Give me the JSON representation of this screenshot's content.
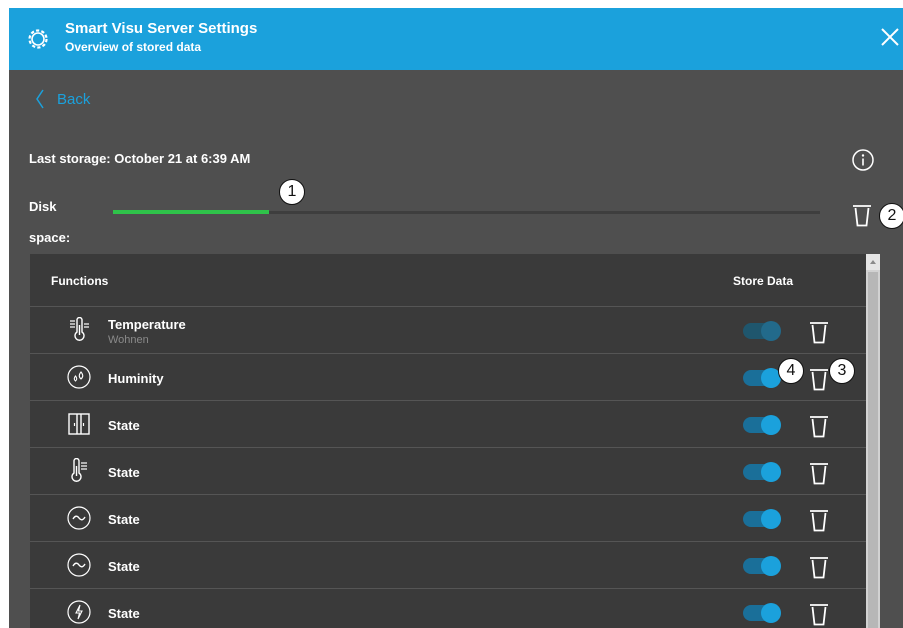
{
  "header": {
    "title": "Smart Visu Server Settings",
    "subtitle": "Overview of stored data",
    "settings_icon": "gear-icon",
    "close_icon": "close-icon"
  },
  "nav": {
    "back_label": "Back"
  },
  "storage": {
    "last_storage_label": "Last storage: October 21 at 6:39 AM",
    "disk_space_label": "Disk space:",
    "disk_used_fraction": 0.22,
    "info_icon": "info-icon",
    "delete_icon": "trash-icon"
  },
  "table": {
    "col_functions": "Functions",
    "col_store_data": "Store Data",
    "rows": [
      {
        "icon": "thermometer-icon",
        "name": "Temperature",
        "room": "Wohnen",
        "store": true,
        "dimmed": true
      },
      {
        "icon": "humidity-icon",
        "name": "Huminity",
        "room": "",
        "store": true,
        "dimmed": false
      },
      {
        "icon": "window-icon",
        "name": "State",
        "room": "",
        "store": true,
        "dimmed": false
      },
      {
        "icon": "thermometer-icon",
        "name": "State",
        "room": "",
        "store": true,
        "dimmed": false
      },
      {
        "icon": "wave-icon",
        "name": "State",
        "room": "",
        "store": true,
        "dimmed": false
      },
      {
        "icon": "wave-icon",
        "name": "State",
        "room": "",
        "store": true,
        "dimmed": false
      },
      {
        "icon": "lightning-icon",
        "name": "State",
        "room": "",
        "store": true,
        "dimmed": false
      }
    ]
  },
  "callouts": {
    "c1": "1",
    "c2": "2",
    "c3": "3",
    "c4": "4"
  },
  "colors": {
    "accent": "#1ba1dc",
    "disk_fill": "#2fc34a",
    "panel": "#4f4f4f",
    "table": "#3a3a3a"
  }
}
